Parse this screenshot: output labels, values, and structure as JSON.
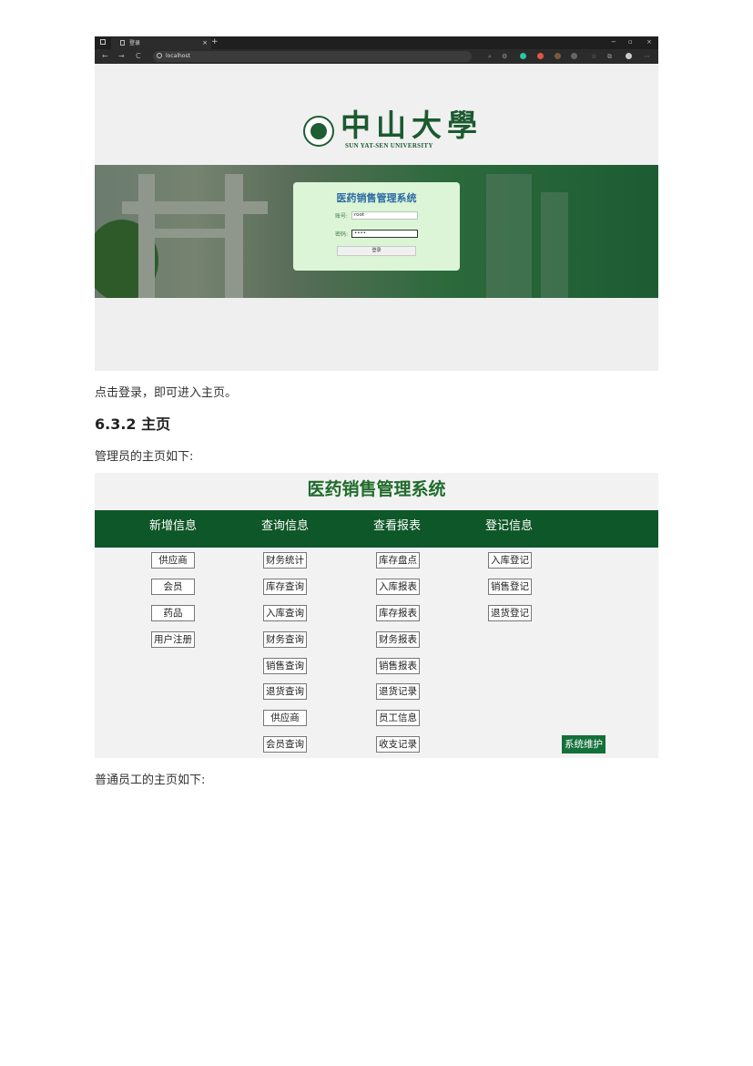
{
  "browser": {
    "tab_title": "登录",
    "tab_close": "×",
    "new_tab": "+",
    "window_controls": [
      "−",
      "▫",
      "×"
    ],
    "nav": [
      "←",
      "→",
      "C"
    ],
    "url": "localhost",
    "toolbar_glyphs": [
      "⌕",
      "⚙",
      "☆",
      "⧉",
      "⋯"
    ]
  },
  "login_page": {
    "university_cn": "中山大學",
    "university_en": "SUN YAT-SEN UNIVERSITY",
    "system_title": "医药销售管理系统",
    "account_label": "账号:",
    "account_value": "root",
    "password_label": "密码:",
    "password_value": "••••",
    "login_button": "登录"
  },
  "doc": {
    "after_login": "点击登录，即可进入主页。",
    "section": "6.3.2 主页",
    "admin_caption": "管理员的主页如下:",
    "staff_caption": "普通员工的主页如下:"
  },
  "home": {
    "title": "医药销售管理系统",
    "nav": [
      "新增信息",
      "查询信息",
      "查看报表",
      "登记信息"
    ],
    "col_add": [
      "供应商",
      "会员",
      "药品",
      "用户注册"
    ],
    "col_query": [
      "财务统计",
      "库存查询",
      "入库查询",
      "财务查询",
      "销售查询",
      "退货查询",
      "供应商",
      "会员查询"
    ],
    "col_report": [
      "库存盘点",
      "入库报表",
      "库存报表",
      "财务报表",
      "销售报表",
      "退货记录",
      "员工信息",
      "收支记录"
    ],
    "col_register": [
      "入库登记",
      "销售登记",
      "退货登记"
    ],
    "maintain": "系统维护"
  },
  "colors": {
    "brand_green": "#0e5728",
    "title_green": "#1f6b2b",
    "login_card": "#dbf5d6",
    "login_title": "#2d6aa5"
  }
}
